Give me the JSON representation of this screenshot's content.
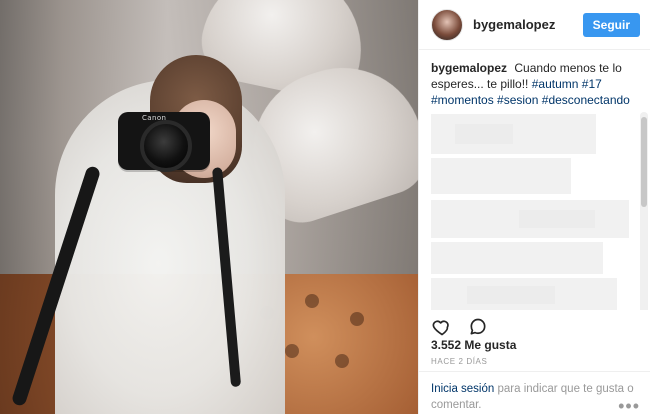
{
  "post": {
    "username": "bygemalopez",
    "follow_label": "Seguir",
    "caption": {
      "author": "bygemalopez",
      "text_1": "Cuando menos te lo",
      "text_2": "esperes... te pillo!! ",
      "tags": [
        "#autumn",
        "#17",
        "#momentos",
        "#sesion",
        "#desconectando"
      ]
    },
    "likes_text": "3.552 Me gusta",
    "time_text": "HACE 2 DÍAS",
    "footer": {
      "link_text": "Inicia sesión",
      "rest_text": " para indicar que te gusta o comentar."
    }
  },
  "icons": {
    "like": "heart-icon",
    "comment": "comment-icon",
    "more": "more-options-icon",
    "camera": "camera-icon"
  },
  "photo": {
    "camera_brand": "Canon"
  },
  "colors": {
    "follow_button": "#3897f0",
    "link": "#003569",
    "muted": "#999999"
  }
}
